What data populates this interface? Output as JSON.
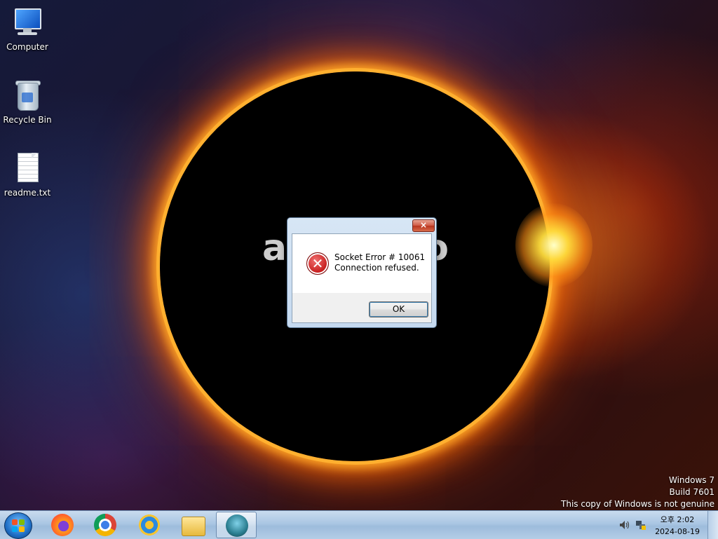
{
  "desktop": {
    "wallpaper_text_left": "a",
    "wallpaper_text_right": "o",
    "icons": [
      {
        "label": "Computer",
        "icon": "computer-icon"
      },
      {
        "label": "Recycle Bin",
        "icon": "recycle-bin-icon"
      },
      {
        "label": "readme.txt",
        "icon": "text-file-icon"
      }
    ]
  },
  "dialog": {
    "close_glyph": "×",
    "error_glyph": "✕",
    "message_line1": "Socket Error # 10061",
    "message_line2": "Connection refused.",
    "ok_label": "OK"
  },
  "watermark": {
    "line1": "Windows 7",
    "line2": "Build 7601",
    "line3": "This copy of Windows is not genuine"
  },
  "taskbar": {
    "items": [
      {
        "name": "firefox",
        "icon": "firefox-icon"
      },
      {
        "name": "chrome",
        "icon": "chrome-icon"
      },
      {
        "name": "internet-explorer",
        "icon": "internet-explorer-icon"
      },
      {
        "name": "file-explorer",
        "icon": "folder-icon"
      },
      {
        "name": "active-app",
        "icon": "app-icon",
        "active": true
      }
    ],
    "clock": {
      "time": "오후 2:02",
      "date": "2024-08-19"
    }
  },
  "colors": {
    "accent": "#3c7fb1",
    "close_red": "#cf5a45",
    "error_red": "#c41818",
    "taskbar": "#aac6e3"
  }
}
